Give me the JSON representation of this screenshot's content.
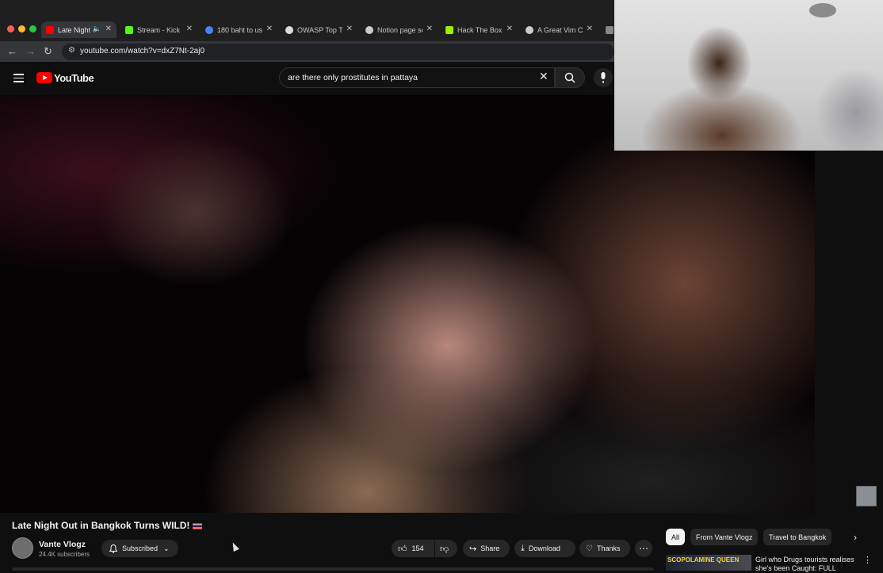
{
  "browser": {
    "tabs": [
      {
        "label": "Late Night",
        "color": "#ff0000"
      },
      {
        "label": "Stream - Kick",
        "color": "#53fc18"
      },
      {
        "label": "180 baht to usd",
        "color": "#4285f4"
      },
      {
        "label": "OWASP Top Te",
        "color": "#dddddd"
      },
      {
        "label": "Notion page se",
        "color": "#cccccc"
      },
      {
        "label": "Hack The Box",
        "color": "#9fef00"
      },
      {
        "label": "A Great Vim Ch",
        "color": "#cccccc"
      }
    ],
    "url": "youtube.com/watch?v=dxZ7Nt-2aj0"
  },
  "youtube": {
    "brand": "YouTube",
    "search_query": "are there only prostitutes in pattaya"
  },
  "video": {
    "title": "Late Night Out in Bangkok Turns WILD!",
    "channel": "Vante Vlogz",
    "subscribers": "24.4K subscribers",
    "subscribe_label": "Subscribed",
    "likes": "154",
    "share_label": "Share",
    "download_label": "Download",
    "thanks_label": "Thanks"
  },
  "chips": [
    "All",
    "From Vante Vlogz",
    "Travel to Bangkok"
  ],
  "recommended": {
    "thumb_text": "SCOPOLAMINE QUEEN",
    "title": "Girl who Drugs tourists realises she's been Caught: FULL"
  }
}
